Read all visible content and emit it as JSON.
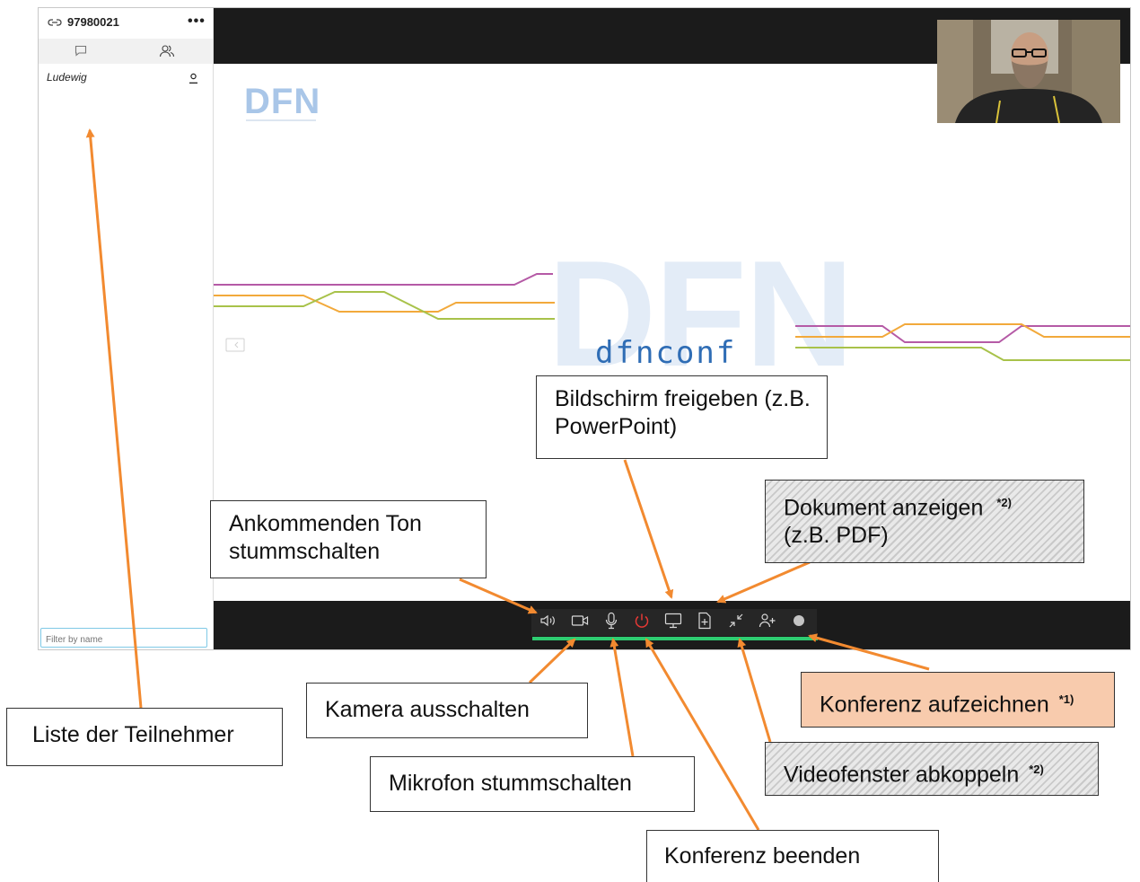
{
  "sidebar": {
    "conference_id": "97980021",
    "more_label": "•••",
    "participant_name": "Ludewig",
    "filter_placeholder": "Filter by name"
  },
  "slide": {
    "small_logo": "DFN",
    "big_logo": "DFN",
    "wordmark": "dfnconf"
  },
  "callouts": {
    "screen_share": "Bildschirm freigeben (z.B. PowerPoint)",
    "document": "Dokument anzeigen",
    "document_sub": "(z.B. PDF)",
    "document_note": "*2)",
    "audio": "Ankommenden Ton stummschalten",
    "camera": "Kamera ausschalten",
    "participants": "Liste der Teilnehmer",
    "microphone": "Mikrofon stummschalten",
    "end": "Konferenz beenden",
    "record": "Konferenz aufzeichnen",
    "record_note": "*1)",
    "popout": "Videofenster abkoppeln",
    "popout_note": "*2)"
  },
  "colors": {
    "accent_line": "#2ecc71",
    "end_red": "#e53935",
    "arrow": "#f28a30",
    "record_highlight": "#f8cbad",
    "dfn_blue": "#2f6db5"
  }
}
